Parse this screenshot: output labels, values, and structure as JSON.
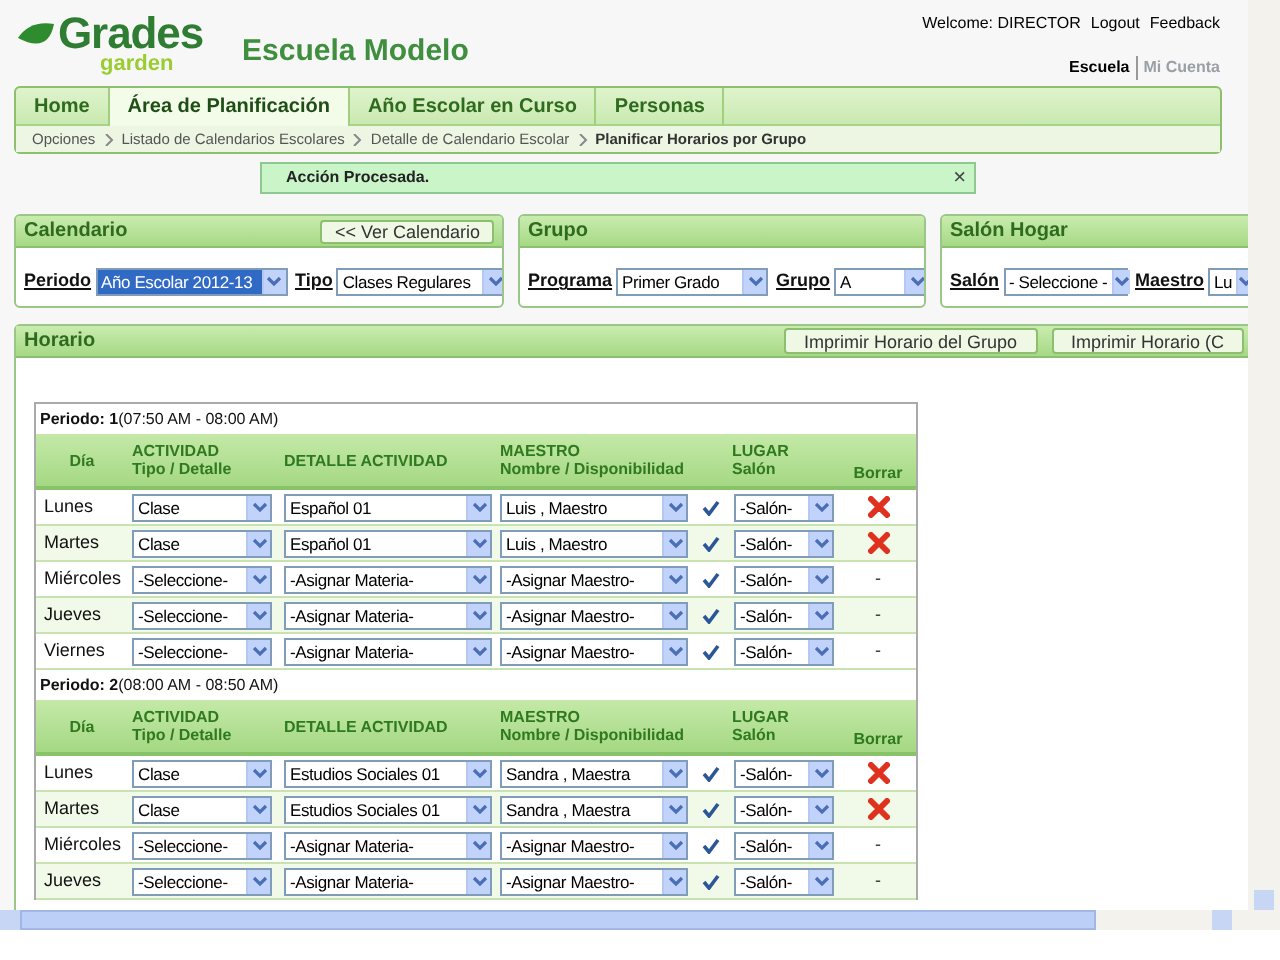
{
  "header": {
    "logo": {
      "top": "Grades",
      "bottom": "garden"
    },
    "school_name": "Escuela Modelo",
    "welcome": "Welcome: DIRECTOR",
    "links": [
      "Logout",
      "Feedback"
    ],
    "context_links": [
      {
        "label": "Escuela",
        "selected": true
      },
      {
        "label": "Mi Cuenta",
        "selected": false
      }
    ]
  },
  "nav_tabs": [
    {
      "label": "Home",
      "selected": false
    },
    {
      "label": "Área de Planificación",
      "selected": true
    },
    {
      "label": "Año Escolar en Curso",
      "selected": false
    },
    {
      "label": "Personas",
      "selected": false
    }
  ],
  "breadcrumb": [
    "Opciones",
    "Listado de Calendarios Escolares",
    "Detalle de Calendario Escolar",
    "Planificar Horarios por Grupo"
  ],
  "message": {
    "text": "Acción Procesada.",
    "close": "×"
  },
  "panels": [
    {
      "title": "Calendario",
      "button": "<< Ver Calendario",
      "fields": [
        {
          "label": "Periodo",
          "value": "Año Escolar 2012-13",
          "highlighted": true
        },
        {
          "label": "Tipo",
          "value": "Clases Regulares",
          "highlighted": false
        }
      ]
    },
    {
      "title": "Grupo",
      "fields": [
        {
          "label": "Programa",
          "value": "Primer Grado",
          "highlighted": false
        },
        {
          "label": "Grupo",
          "value": "A",
          "highlighted": false
        }
      ]
    },
    {
      "title": "Salón Hogar",
      "fields": [
        {
          "label": "Salón",
          "value": "- Seleccione -",
          "highlighted": false
        },
        {
          "label": "Maestro",
          "value": "Lu",
          "highlighted": false
        }
      ]
    }
  ],
  "horario": {
    "title": "Horario",
    "buttons": [
      "Imprimir Horario del Grupo",
      "Imprimir Horario (C"
    ],
    "periods": [
      {
        "label": "Periodo: 1",
        "time": "(07:50 AM - 08:00 AM)",
        "columns": [
          {
            "title": "Día"
          },
          {
            "title": "ACTIVIDAD",
            "subtitle": "Tipo / Detalle"
          },
          {
            "title": "DETALLE ACTIVIDAD"
          },
          {
            "title": "MAESTRO",
            "subtitle": "Nombre / Disponibilidad"
          },
          {},
          {
            "title": "LUGAR",
            "subtitle": "Salón"
          },
          {
            "title": "Borrar"
          }
        ],
        "rows": [
          {
            "day": "Lunes",
            "tipo": "Clase",
            "detalle": "Español 01",
            "maestro": "Luis , Maestro",
            "available": true,
            "salon": "-Salón-",
            "action": {
              "kind": "delete"
            }
          },
          {
            "day": "Martes",
            "tipo": "Clase",
            "detalle": "Español 01",
            "maestro": "Luis , Maestro",
            "available": true,
            "salon": "-Salón-",
            "action": {
              "kind": "delete"
            }
          },
          {
            "day": "Miércoles",
            "tipo": "-Seleccione-",
            "detalle": "-Asignar Materia-",
            "maestro": "-Asignar Maestro-",
            "available": true,
            "salon": "-Salón-",
            "action": {
              "kind": "none",
              "text": "-"
            }
          },
          {
            "day": "Jueves",
            "tipo": "-Seleccione-",
            "detalle": "-Asignar Materia-",
            "maestro": "-Asignar Maestro-",
            "available": true,
            "salon": "-Salón-",
            "action": {
              "kind": "none",
              "text": "-"
            }
          },
          {
            "day": "Viernes",
            "tipo": "-Seleccione-",
            "detalle": "-Asignar Materia-",
            "maestro": "-Asignar Maestro-",
            "available": true,
            "salon": "-Salón-",
            "action": {
              "kind": "none",
              "text": "-"
            }
          }
        ]
      },
      {
        "label": "Periodo: 2",
        "time": "(08:00 AM - 08:50 AM)",
        "columns": [
          {
            "title": "Día"
          },
          {
            "title": "ACTIVIDAD",
            "subtitle": "Tipo / Detalle"
          },
          {
            "title": "DETALLE ACTIVIDAD"
          },
          {
            "title": "MAESTRO",
            "subtitle": "Nombre / Disponibilidad"
          },
          {},
          {
            "title": "LUGAR",
            "subtitle": "Salón"
          },
          {
            "title": "Borrar"
          }
        ],
        "rows": [
          {
            "day": "Lunes",
            "tipo": "Clase",
            "detalle": "Estudios Sociales 01",
            "maestro": "Sandra , Maestra",
            "available": true,
            "salon": "-Salón-",
            "action": {
              "kind": "delete"
            }
          },
          {
            "day": "Martes",
            "tipo": "Clase",
            "detalle": "Estudios Sociales 01",
            "maestro": "Sandra , Maestra",
            "available": true,
            "salon": "-Salón-",
            "action": {
              "kind": "delete"
            }
          },
          {
            "day": "Miércoles",
            "tipo": "-Seleccione-",
            "detalle": "-Asignar Materia-",
            "maestro": "-Asignar Maestro-",
            "available": true,
            "salon": "-Salón-",
            "action": {
              "kind": "none",
              "text": "-"
            }
          },
          {
            "day": "Jueves",
            "tipo": "-Seleccione-",
            "detalle": "-Asignar Materia-",
            "maestro": "-Asignar Maestro-",
            "available": true,
            "salon": "-Salón-",
            "action": {
              "kind": "none",
              "text": "-"
            }
          }
        ]
      }
    ]
  }
}
